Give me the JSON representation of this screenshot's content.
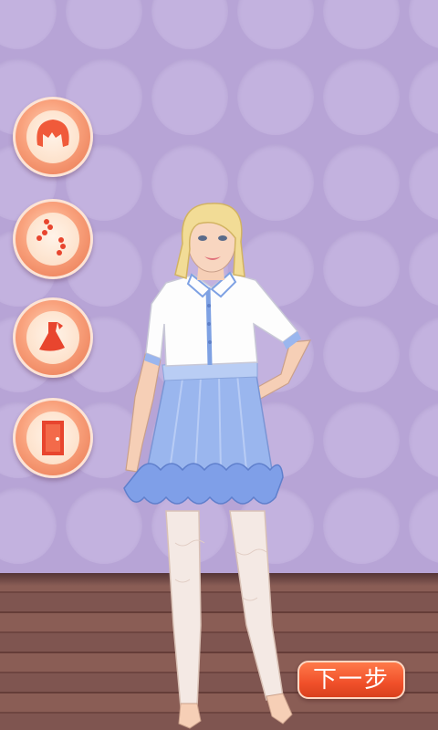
{
  "scene": {
    "wall_color": "#b7a4d6",
    "dot_color": "#c3b2df",
    "floor_color": "#7f5550"
  },
  "sidebar": {
    "items": [
      {
        "id": "hair",
        "icon": "hair-icon"
      },
      {
        "id": "accessories",
        "icon": "bead-necklace-icon"
      },
      {
        "id": "dress",
        "icon": "dress-icon"
      },
      {
        "id": "door",
        "icon": "door-icon"
      }
    ]
  },
  "footer": {
    "next_label": "下一步"
  }
}
